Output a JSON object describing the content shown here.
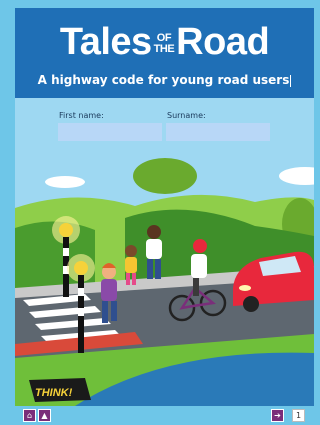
{
  "title": {
    "part1": "Tales",
    "of_top": "OF",
    "of_bottom": "THE",
    "part2": "Road"
  },
  "subtitle": "A highway code for young road users",
  "form": {
    "first_name_label": "First name:",
    "first_name_value": "",
    "surname_label": "Surname:",
    "surname_value": ""
  },
  "scene": {
    "road_sign_text": "THINK!"
  },
  "nav": {
    "home_icon": "home-icon",
    "car_icon": "car-icon",
    "next_icon": "next-arrow-icon",
    "page_number": "1"
  },
  "colors": {
    "header_blue": "#1f6fb6",
    "field_blue": "#b8d7f7",
    "nav_purple": "#7a2e7a",
    "grass_green": "#6fbf3a",
    "car_red": "#e8283c"
  }
}
